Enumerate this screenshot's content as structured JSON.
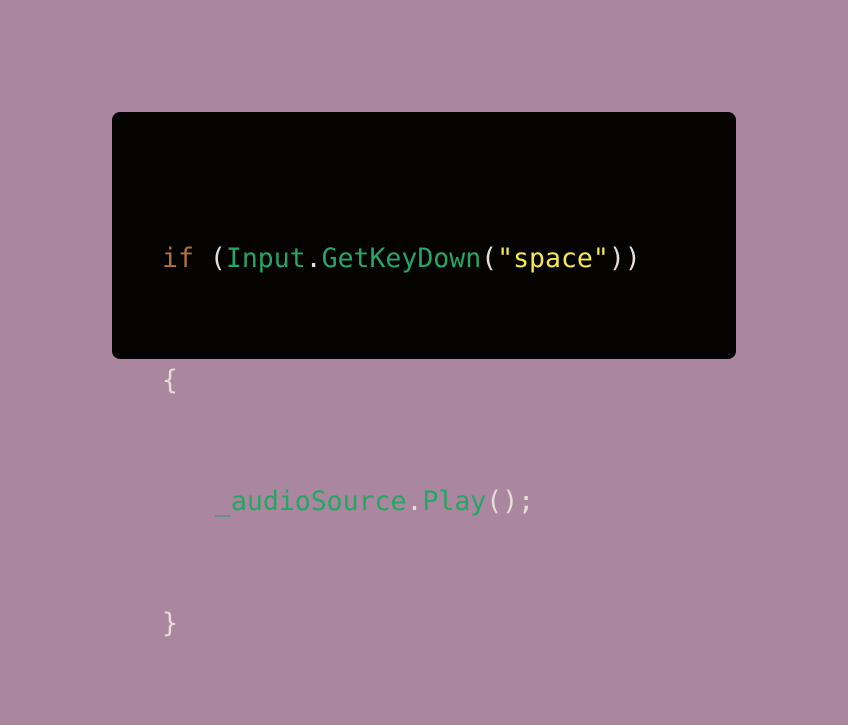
{
  "theme": {
    "background": "#aa879f",
    "card_background": "#050202",
    "keyword_color": "#b2703d",
    "identifier_color": "#25a566",
    "string_color": "#f4e84c",
    "punctuation_color": "#e7dcd8"
  },
  "code": {
    "line1": {
      "keyword": "if",
      "space": " ",
      "open_paren": "(",
      "class_name": "Input",
      "dot": ".",
      "method": "GetKeyDown",
      "call_open": "(",
      "string": "\"space\"",
      "close_parens": "))"
    },
    "line2": {
      "open_brace": "{"
    },
    "line3": {
      "object": "_audioSource",
      "dot": ".",
      "method": "Play",
      "call": "();"
    },
    "line4": {
      "close_brace": "}"
    }
  }
}
